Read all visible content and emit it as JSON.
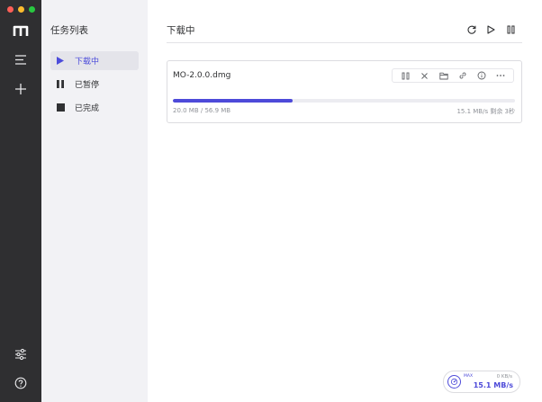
{
  "sidebar": {
    "title": "任务列表",
    "items": [
      {
        "label": "下载中",
        "icon": "play-icon"
      },
      {
        "label": "已暂停",
        "icon": "pause-icon"
      },
      {
        "label": "已完成",
        "icon": "stop-square-icon"
      }
    ]
  },
  "main": {
    "title": "下载中",
    "actions": [
      "refresh-icon",
      "play-icon",
      "pause-icon"
    ]
  },
  "task": {
    "name": "MO-2.0.0.dmg",
    "progress_percent": 35,
    "size_text": "20.0 MB / 56.9 MB",
    "speed_text": "15.1 MB/s 剩余 3秒",
    "tools": [
      "pause-icon",
      "close-icon",
      "folder-icon",
      "link-icon",
      "info-icon",
      "more-icon"
    ]
  },
  "speedometer": {
    "max_label": "MAX",
    "upload": "0 KB/s",
    "download": "15.1 MB/s"
  },
  "colors": {
    "accent": "#4d4ad9",
    "rail": "#2f2f31",
    "sidebar": "#f2f2f5"
  }
}
